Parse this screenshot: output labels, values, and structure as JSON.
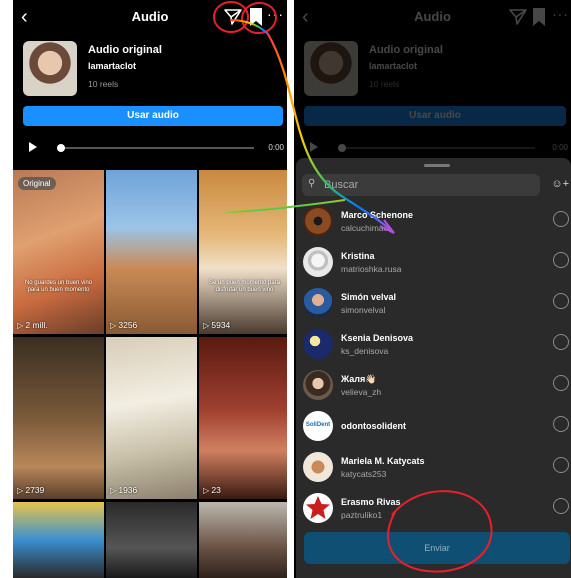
{
  "left": {
    "title": "Audio",
    "audio": {
      "title": "Audio original",
      "user": "lamartaclot",
      "reels": "10 reels"
    },
    "use_audio_label": "Usar audio",
    "time": "0:00",
    "badge": "Original",
    "tiles": [
      {
        "views": "2 mill.",
        "caption": "No guardes un buen vino para un buen momento"
      },
      {
        "views": "3256",
        "caption": ""
      },
      {
        "views": "5934",
        "caption": "Se un buen momento para disfrutar un buen vino"
      },
      {
        "views": "2739",
        "caption": ""
      },
      {
        "views": "1936",
        "caption": ""
      },
      {
        "views": "23",
        "caption": ""
      }
    ]
  },
  "right": {
    "title": "Audio",
    "audio": {
      "title": "Audio original",
      "user": "lamartaclot",
      "reels": "10 reels"
    },
    "use_audio_label": "Usar audio",
    "time": "0:00",
    "search_placeholder": "Buscar",
    "contacts": [
      {
        "name": "Marco Schenone",
        "handle": "calcuchimac"
      },
      {
        "name": "Kristina",
        "handle": "matrioshka.rusa"
      },
      {
        "name": "Simón velval",
        "handle": "simonvelval"
      },
      {
        "name": "Ksenia Denisova",
        "handle": "ks_denisova"
      },
      {
        "name": "Жаля👋🏻",
        "handle": "velieva_zh"
      },
      {
        "name": "odontosolident",
        "handle": ""
      },
      {
        "name": "Mariela M. Katycats",
        "handle": "katycats253"
      },
      {
        "name": "Erasmo Rivas",
        "handle": "paztruliko1"
      }
    ],
    "avatar_logo_text": "SoliDent",
    "send_label": "Enviar"
  },
  "colors": {
    "accent": "#1a8fff",
    "annotation_red": "#e8202a",
    "send_button": "#0f4f73"
  }
}
